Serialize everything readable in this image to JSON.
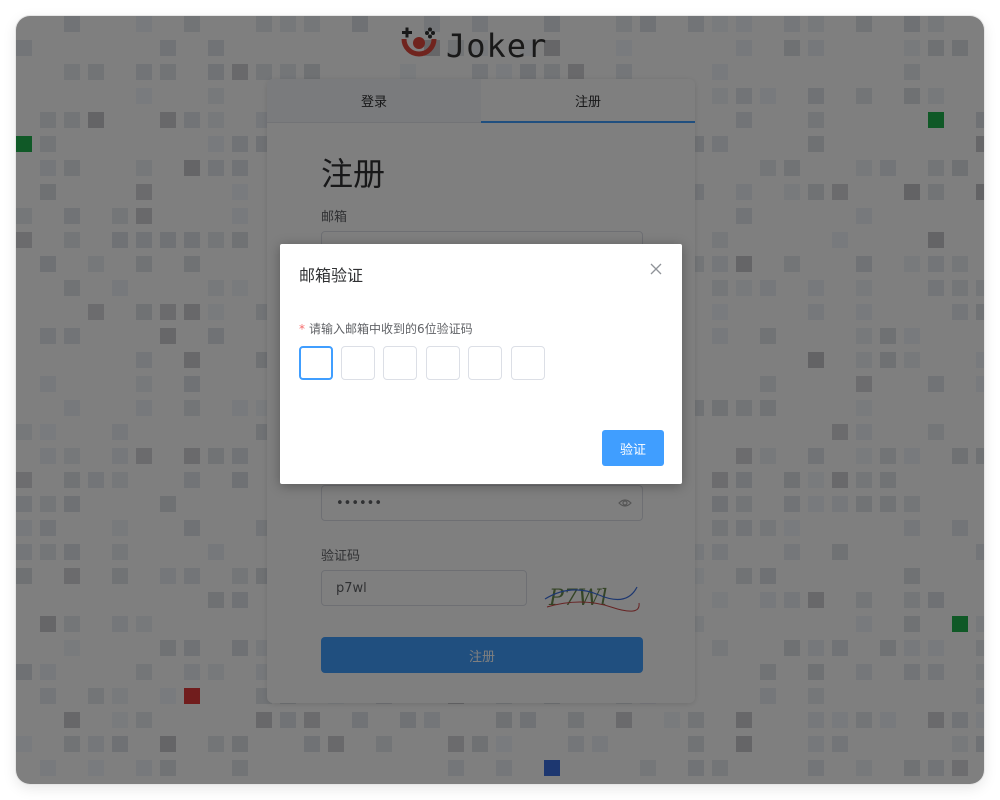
{
  "app": {
    "logo_text": "Joker"
  },
  "tabs": [
    {
      "label": "登录",
      "active": false
    },
    {
      "label": "注册",
      "active": true
    }
  ],
  "register_form": {
    "title": "注册",
    "email_label": "邮箱",
    "password_value": "••••••",
    "captcha_label": "验证码",
    "captcha_value": "p7wl",
    "captcha_image_text": "P7Wl",
    "submit_label": "注册"
  },
  "dialog": {
    "title": "邮箱验证",
    "required_mark": "*",
    "prompt": "请输入邮箱中收到的6位验证码",
    "code_digits": [
      "",
      "",
      "",
      "",
      "",
      ""
    ],
    "verify_label": "验证"
  },
  "colors": {
    "accent": "#409eff",
    "overlay": "rgba(0,0,0,0.5)",
    "grid_green": "#21b24f",
    "grid_red": "#e23b3b",
    "grid_blue": "#3a6fe0"
  },
  "icons": {
    "logo": "joker-clown-icon",
    "close": "close-icon",
    "password_toggle": "eye-icon"
  }
}
